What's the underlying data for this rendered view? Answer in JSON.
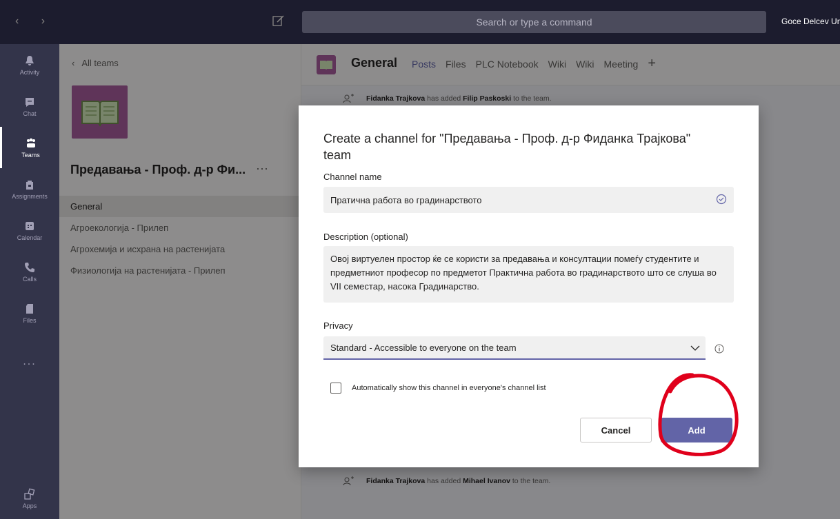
{
  "topbar": {
    "search_placeholder": "Search or type a command",
    "org_name": "Goce Delcev Univ"
  },
  "rail": {
    "items": [
      {
        "label": "Activity",
        "icon": "bell-icon"
      },
      {
        "label": "Chat",
        "icon": "chat-icon"
      },
      {
        "label": "Teams",
        "icon": "teams-icon"
      },
      {
        "label": "Assignments",
        "icon": "backpack-icon"
      },
      {
        "label": "Calendar",
        "icon": "calendar-icon"
      },
      {
        "label": "Calls",
        "icon": "phone-icon"
      },
      {
        "label": "Files",
        "icon": "file-icon"
      }
    ],
    "more": "...",
    "apps": "Apps"
  },
  "left_panel": {
    "back_label": "All teams",
    "team_name": "Предавања - Проф. д-р Фи...",
    "team_more": "···",
    "channels": [
      "General",
      "Агроекологија - Прилеп",
      "Агрохемија и исхрана на растенијата",
      "Физиологија на растенијата - Прилеп"
    ]
  },
  "main": {
    "channel_title": "General",
    "tabs": [
      "Posts",
      "Files",
      "PLC Notebook",
      "Wiki",
      "Wiki",
      "Meeting"
    ],
    "tab_add": "+",
    "activity_top": {
      "actor": "Fidanka Trajkova",
      "action": "has added",
      "target": "Filip Paskoski",
      "suffix": "to the team."
    },
    "activity_bottom": {
      "actor": "Fidanka Trajkova",
      "action": "has added",
      "target": "Mihael Ivanov",
      "suffix": "to the team."
    }
  },
  "dialog": {
    "title": "Create a channel for \"Предавања - Проф. д-р Фиданка Трајкова\" team",
    "name_label": "Channel name",
    "name_value": "Пратична работа во градинарството",
    "description_label": "Description (optional)",
    "description_value": "Овој виртуелен простор ќе се користи за предавања и консултации помеѓу студентите и предметниот професор по предметот Практична работа во градинарството што се слуша во VII семестар, насока Градинарство.",
    "privacy_label": "Privacy",
    "privacy_value": "Standard - Accessible to everyone on the team",
    "auto_show_label": "Automatically show this channel in everyone's channel list",
    "cancel_label": "Cancel",
    "add_label": "Add"
  },
  "colors": {
    "accent": "#6264a7",
    "rail": "#33344a",
    "topbar": "#1c1c2e",
    "team_tile": "#a45a9a",
    "annotation": "#e0001b"
  }
}
